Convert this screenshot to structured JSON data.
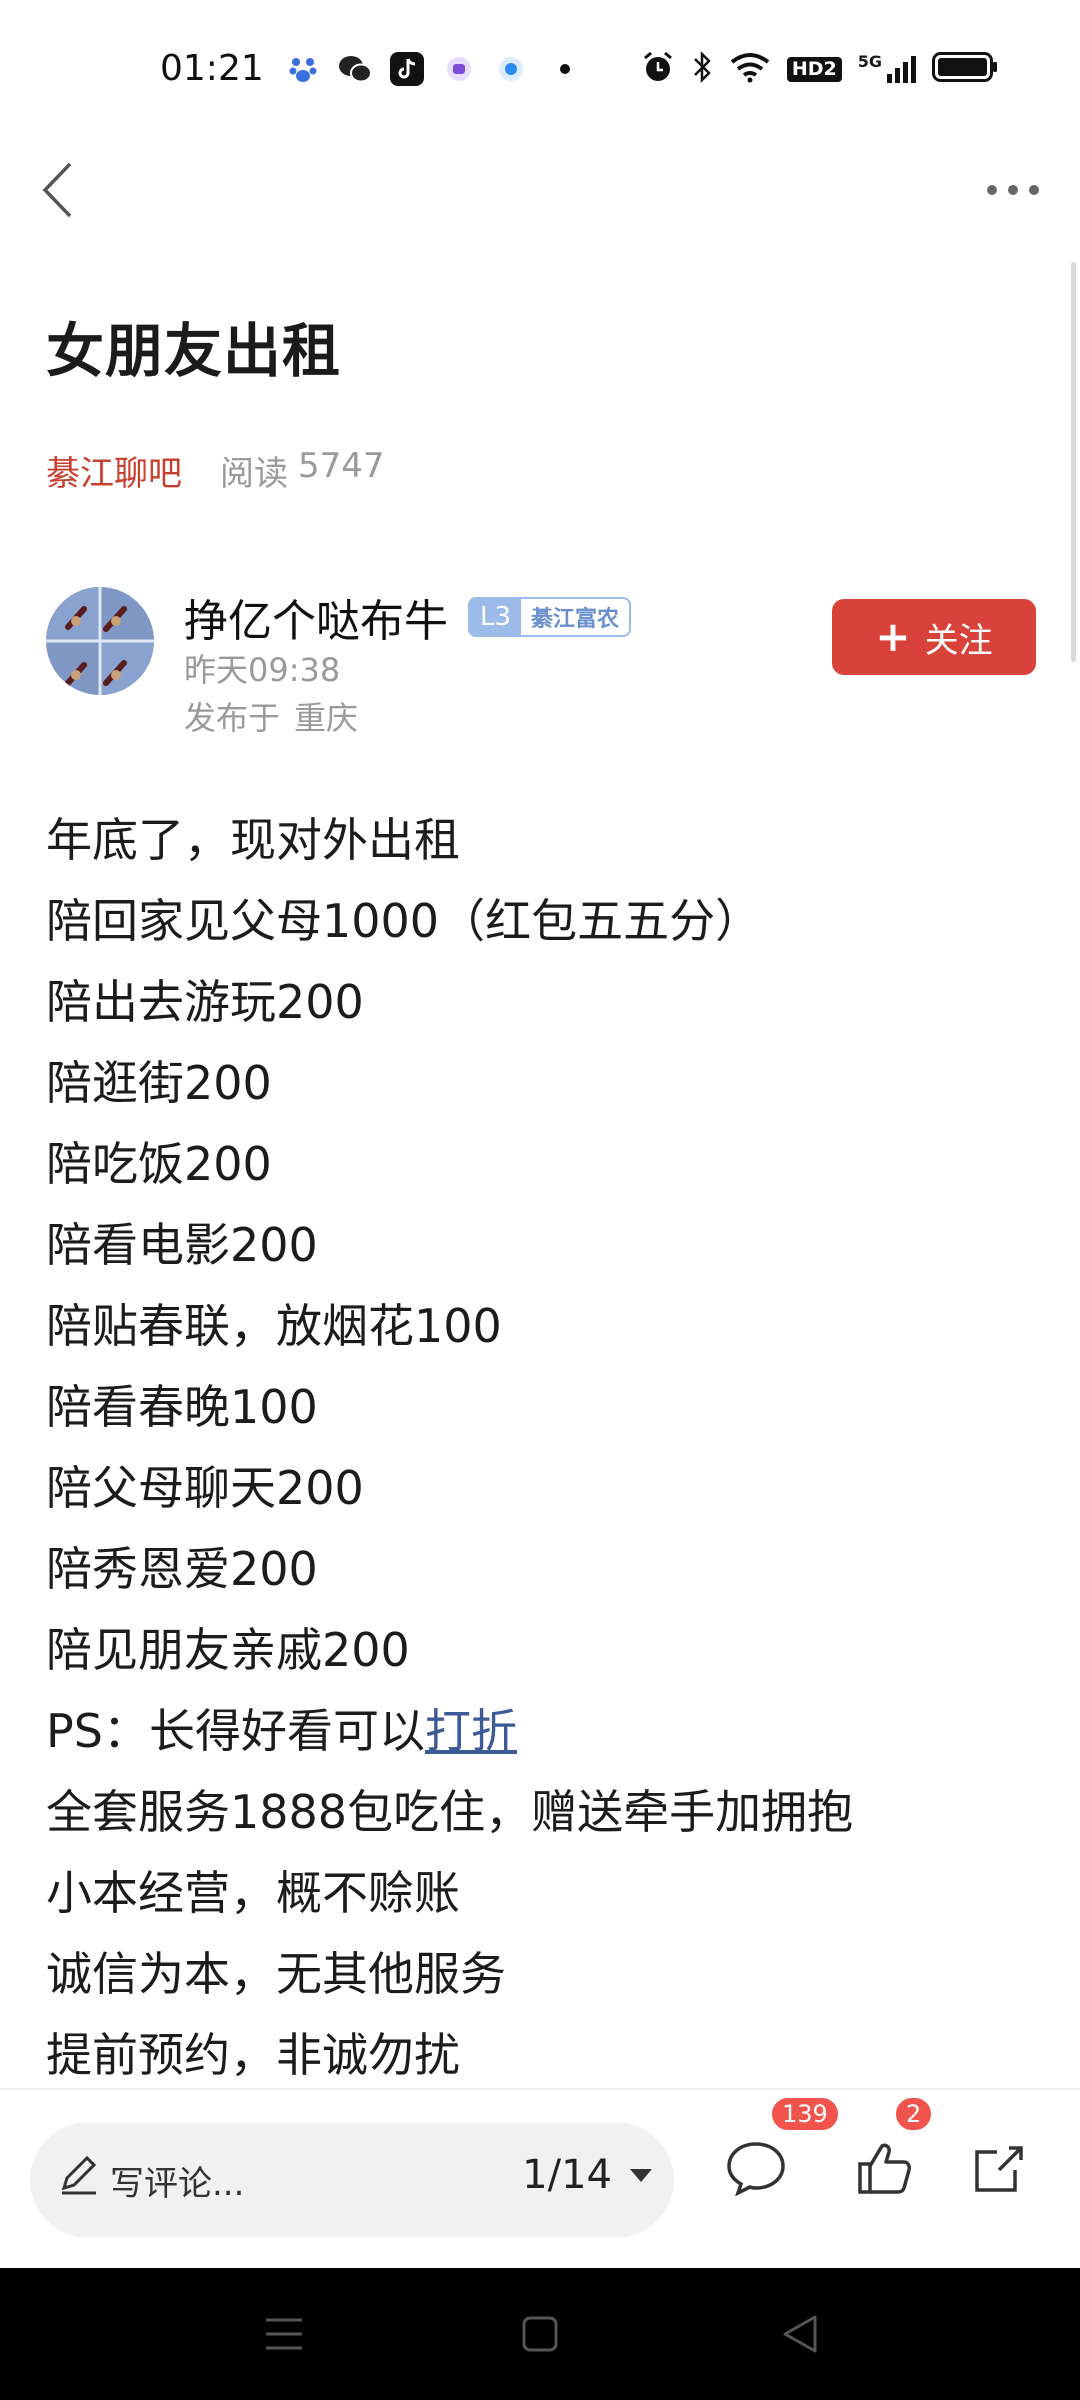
{
  "status_bar": {
    "time": "01:21",
    "apps": [
      "baidu-icon",
      "wechat-icon",
      "tiktok-icon",
      "purple-app-icon",
      "blue-app-icon"
    ],
    "hd_label": "HD2",
    "signal_label": "5G"
  },
  "header": {
    "back_icon": "chevron-left-icon",
    "more_icon": "more-dots-icon"
  },
  "post": {
    "title": "女朋友出租",
    "forum": "綦江聊吧",
    "read_label": "阅读",
    "read_count": "5747"
  },
  "author": {
    "name": "挣亿个哒布牛",
    "level": "L3",
    "level_title": "綦江富农",
    "time": "昨天09:38",
    "published_label": "发布于",
    "location": "重庆",
    "follow_label": "关注"
  },
  "body": {
    "lines": [
      "年底了，现对外出租",
      "陪回家见父母1000（红包五五分）",
      "陪出去游玩200",
      "陪逛街200",
      "陪吃饭200",
      "陪看电影200",
      "陪贴春联，放烟花100",
      "陪看春晚100",
      "陪父母聊天200",
      "陪秀恩爱200",
      "陪见朋友亲戚200"
    ],
    "ps_prefix": "PS：长得好看可以",
    "ps_link": "打折",
    "lines_after": [
      "全套服务1888包吃住，赠送牵手加拥抱",
      "小本经营，概不赊账",
      "诚信为本，无其他服务",
      "提前预约，非诚勿扰"
    ]
  },
  "bottom_bar": {
    "comment_placeholder": "写评论...",
    "page_indicator": "1/14",
    "comment_count": "139",
    "like_count": "2"
  },
  "colors": {
    "accent_red": "#d9423a",
    "forum_red": "#c8402f",
    "muted_gray": "#9a9a9a",
    "badge_blue": "#9dbbea"
  }
}
